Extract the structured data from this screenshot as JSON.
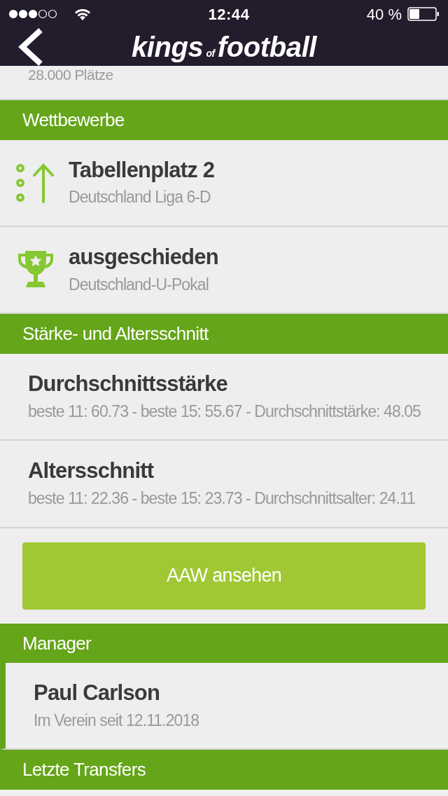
{
  "status_bar": {
    "time": "12:44",
    "battery": "40 %"
  },
  "nav": {
    "logo_main": "kings",
    "logo_small": "of",
    "logo_end": "football"
  },
  "partial_row": {
    "subtitle": "28.000 Plätze"
  },
  "sections": [
    {
      "title": "Wettbewerbe",
      "items": [
        {
          "kind": "league",
          "title": "Tabellenplatz 2",
          "subtitle": "Deutschland Liga 6-D",
          "highlighted": false
        },
        {
          "kind": "cup",
          "title": "ausgeschieden",
          "subtitle": "Deutschland-U-Pokal",
          "highlighted": false
        }
      ]
    },
    {
      "title": "Stärke- und Altersschnitt",
      "items": [
        {
          "kind": "plain",
          "title": "Durchschnittsstärke",
          "subtitle": "beste 11: 60.73 - beste 15: 55.67 - Durchschnittstärke: 48.05",
          "highlighted": false
        },
        {
          "kind": "plain",
          "title": "Altersschnitt",
          "subtitle": "beste 11: 22.36 - beste 15: 23.73 - Durchschnittsalter: 24.11",
          "highlighted": false
        }
      ],
      "button": "AAW ansehen"
    },
    {
      "title": "Manager",
      "items": [
        {
          "kind": "plain",
          "title": "Paul Carlson",
          "subtitle": "Im Verein seit 12.11.2018",
          "highlighted": true
        }
      ]
    },
    {
      "title": "Letzte Transfers"
    }
  ]
}
